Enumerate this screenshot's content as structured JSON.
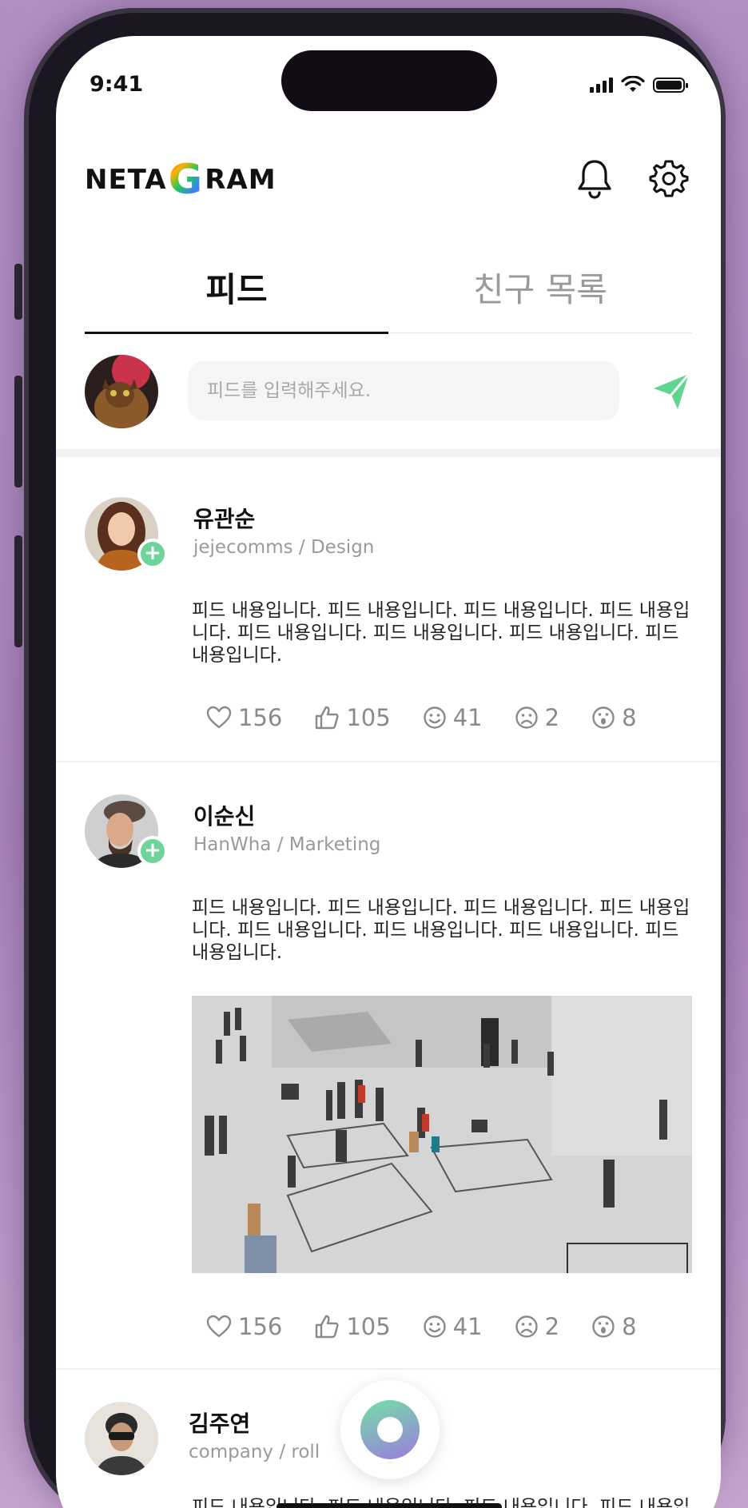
{
  "status_bar": {
    "time": "9:41"
  },
  "header": {
    "logo_parts": [
      "NETA",
      "G",
      "RAM"
    ]
  },
  "tabs": [
    {
      "label": "피드",
      "active": true
    },
    {
      "label": "친구 목록",
      "active": false
    }
  ],
  "composer": {
    "placeholder": "피드를 입력해주세요."
  },
  "posts": [
    {
      "name": "유관순",
      "meta": "jejecomms / Design",
      "content": "피드 내용입니다. 피드 내용입니다. 피드 내용입니다. 피드 내용입니다. 피드 내용입니다. 피드 내용입니다. 피드 내용입니다. 피드 내용입니다.",
      "reactions": {
        "heart": "156",
        "like": "105",
        "smile": "41",
        "sad": "2",
        "wow": "8"
      }
    },
    {
      "name": "이순신",
      "meta": "HanWha / Marketing",
      "content": "피드 내용입니다. 피드 내용입니다. 피드 내용입니다. 피드 내용입니다. 피드 내용입니다. 피드 내용입니다. 피드 내용입니다. 피드 내용입니다.",
      "has_image": true,
      "reactions": {
        "heart": "156",
        "like": "105",
        "smile": "41",
        "sad": "2",
        "wow": "8"
      }
    },
    {
      "name": "김주연",
      "meta": "company / roll",
      "content": "피드 내용입니다. 피드 내용입니다. 피드 내용입니다. 피드 내용입니다. 피드 내용입니다. 피드 내용입니다. 피드 내용입니다. 피드 내용입니다."
    }
  ],
  "colors": {
    "accent_green": "#6fd49b",
    "send_green": "#5fd58f",
    "text_gray": "#9a9a9a"
  },
  "icons": [
    "bell-icon",
    "gear-icon",
    "send-icon",
    "heart-icon",
    "thumbs-up-icon",
    "smile-icon",
    "sad-icon",
    "wow-icon",
    "plus-icon"
  ]
}
